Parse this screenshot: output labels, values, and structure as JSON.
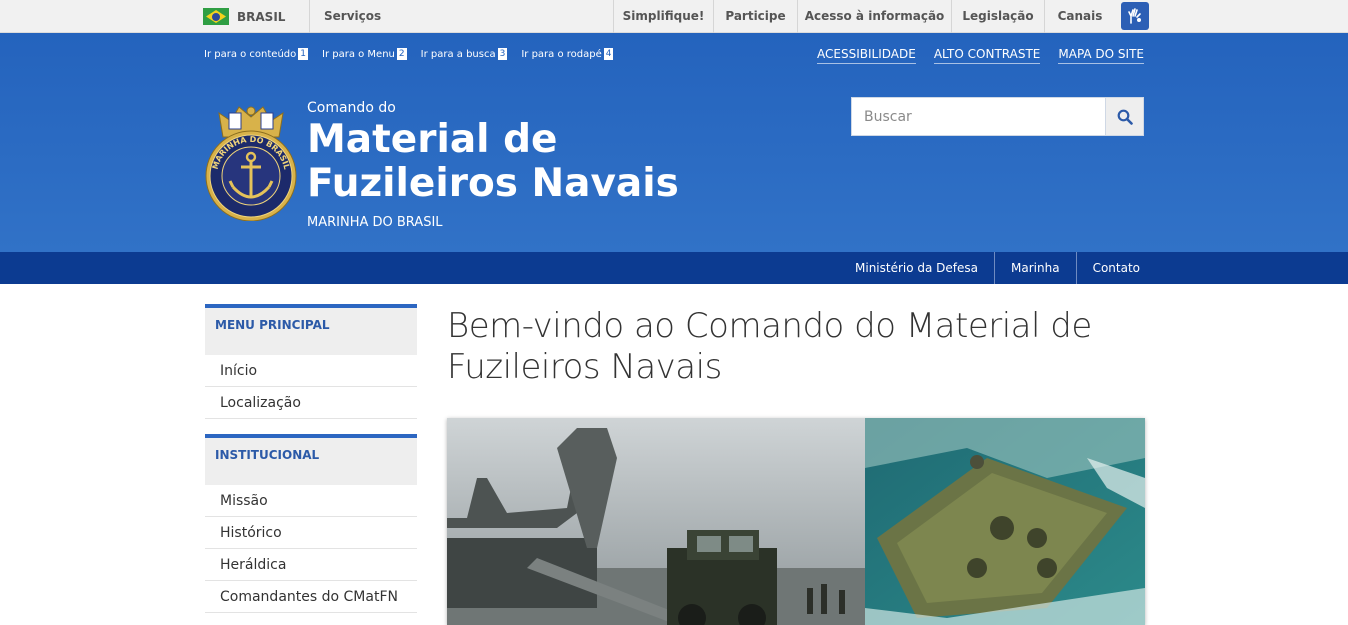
{
  "govbar": {
    "country": "BRASIL",
    "services": "Serviços",
    "links": [
      {
        "label": "Simplifique!",
        "width": 100
      },
      {
        "label": "Participe",
        "width": 84
      },
      {
        "label": "Acesso à informação",
        "width": 154
      },
      {
        "label": "Legislação",
        "width": 93
      },
      {
        "label": "Canais",
        "width": 71
      }
    ]
  },
  "skip_links": [
    {
      "label": "Ir para o conteúdo",
      "key": "1"
    },
    {
      "label": "Ir para o Menu",
      "key": "2"
    },
    {
      "label": "Ir para a busca",
      "key": "3"
    },
    {
      "label": "Ir para o rodapé",
      "key": "4"
    }
  ],
  "accessibility": {
    "items": [
      "ACESSIBILIDADE",
      "ALTO CONTRASTE",
      "MAPA DO SITE"
    ]
  },
  "site": {
    "pre_title": "Comando do",
    "title": "Material de Fuzileiros Navais",
    "post_title": "MARINHA DO BRASIL",
    "emblem_text": "MARINHA DO BRASIL"
  },
  "search": {
    "placeholder": "Buscar",
    "icon": "search-icon"
  },
  "navbar": {
    "links": [
      "Ministério da Defesa",
      "Marinha",
      "Contato"
    ]
  },
  "sidebar": {
    "sections": [
      {
        "title": "MENU PRINCIPAL",
        "items": [
          "Início",
          "Localização"
        ]
      },
      {
        "title": "INSTITUCIONAL",
        "items": [
          "Missão",
          "Histórico",
          "Heráldica",
          "Comandantes do CMatFN"
        ]
      }
    ]
  },
  "main": {
    "heading": "Bem-vindo ao Comando do Material de Fuzileiros Navais"
  },
  "colors": {
    "header_blue": "#2463bd",
    "navbar_blue": "#0c3b91",
    "sidebar_accent": "#2c66c1"
  }
}
